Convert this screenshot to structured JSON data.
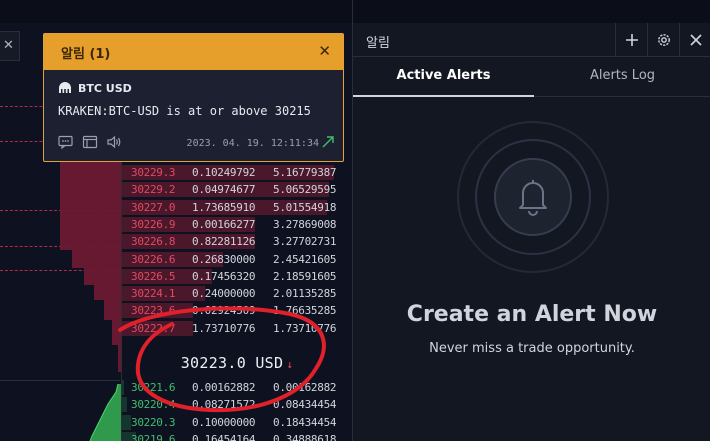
{
  "toast": {
    "title": "알림 (1)",
    "symbol": "BTC USD",
    "message": "KRAKEN:BTC-USD is at or above 30215",
    "timestamp": "2023. 04. 19. 12:11:34",
    "icons": [
      "comment-icon",
      "popup-window-icon",
      "speaker-icon"
    ],
    "accent_color": "#e79f2c"
  },
  "orderbook": {
    "asks": [
      {
        "price": "30229.3",
        "size": "0.10249792",
        "total": "5.16779387",
        "depth": 0.92
      },
      {
        "price": "30229.2",
        "size": "0.04974677",
        "total": "5.06529595",
        "depth": 0.9
      },
      {
        "price": "30227.0",
        "size": "1.73685910",
        "total": "5.01554918",
        "depth": 0.89
      },
      {
        "price": "30226.9",
        "size": "0.00166277",
        "total": "3.27869008",
        "depth": 0.58
      },
      {
        "price": "30226.8",
        "size": "0.82281126",
        "total": "3.27702731",
        "depth": 0.58
      },
      {
        "price": "30226.6",
        "size": "0.26830000",
        "total": "2.45421605",
        "depth": 0.44
      },
      {
        "price": "30226.5",
        "size": "0.17456320",
        "total": "2.18591605",
        "depth": 0.39
      },
      {
        "price": "30224.1",
        "size": "0.24000000",
        "total": "2.01135285",
        "depth": 0.36
      },
      {
        "price": "30223.6",
        "size": "0.02924509",
        "total": "1.76635285",
        "depth": 0.31
      },
      {
        "price": "30222.7",
        "size": "1.73710776",
        "total": "1.73710776",
        "depth": 0.31
      }
    ],
    "mid": {
      "price": "30223.0 USD",
      "direction": "down"
    },
    "bids": [
      {
        "price": "30221.6",
        "size": "0.00162882",
        "total": "0.00162882",
        "depth": 0.01
      },
      {
        "price": "30220.4",
        "size": "0.08271572",
        "total": "0.08434454",
        "depth": 0.02
      },
      {
        "price": "30220.3",
        "size": "0.10000000",
        "total": "0.18434454",
        "depth": 0.04
      },
      {
        "price": "30219.6",
        "size": "0.16454164",
        "total": "0.34888618",
        "depth": 0.06
      }
    ],
    "colors": {
      "ask": "#e24a62",
      "bid": "#3fbf6f"
    }
  },
  "panel": {
    "title": "알림",
    "buttons": [
      "plus-icon",
      "gear-icon",
      "close-icon"
    ],
    "tabs": [
      {
        "label": "Active Alerts",
        "active": true
      },
      {
        "label": "Alerts Log",
        "active": false
      }
    ],
    "empty_title": "Create an Alert Now",
    "empty_subtitle": "Never miss a trade opportunity."
  },
  "annotation": {
    "color": "#e0202a"
  }
}
